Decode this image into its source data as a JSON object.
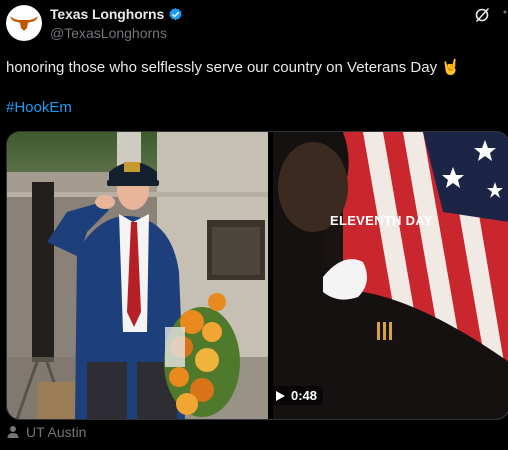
{
  "author": {
    "display_name": "Texas Longhorns",
    "handle": "@TexasLonghorns",
    "verified": true,
    "avatar_icon": "longhorn-logo-icon",
    "brand_color": "#bf5700"
  },
  "post": {
    "text": "honoring those who selflessly serve our country on Veterans Day 🤘",
    "hashtag": "#HookEm",
    "hashtag_color": "#1d9bf0"
  },
  "media": {
    "left_image": "veteran-saluting-photo",
    "right_image": "flag-video-thumbnail",
    "video_caption": "ELEVENTH DAY",
    "duration": "0:48"
  },
  "footer": {
    "location_icon": "person-icon",
    "location": "UT Austin"
  }
}
